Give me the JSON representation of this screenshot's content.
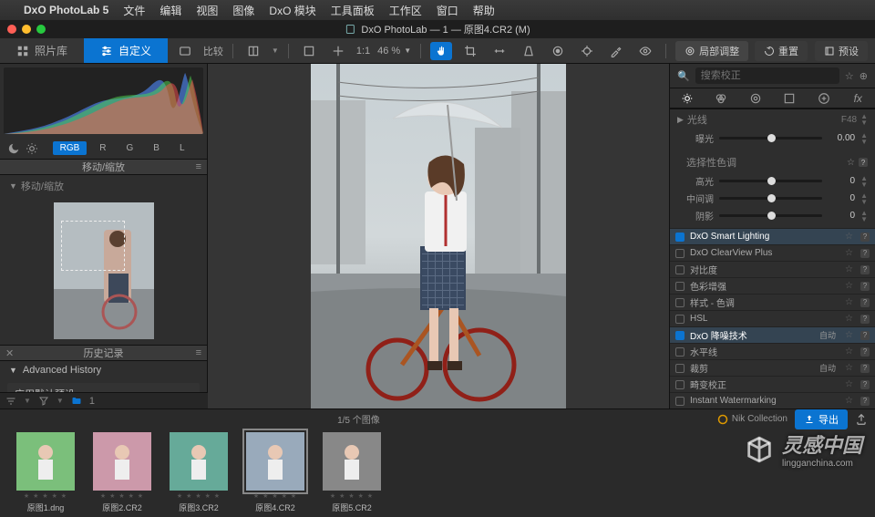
{
  "menubar": {
    "app": "DxO PhotoLab 5",
    "items": [
      "文件",
      "编辑",
      "视图",
      "图像",
      "DxO 模块",
      "工具面板",
      "工作区",
      "窗口",
      "帮助"
    ]
  },
  "titlebar": {
    "title": "DxO PhotoLab — 1 — 原图4.CR2 (M)"
  },
  "modes": {
    "library": "照片库",
    "customize": "自定义"
  },
  "toolbar": {
    "compare": "比较",
    "fit": "1:1",
    "zoom_pct": "46 %",
    "local_adjust": "局部调整",
    "reset": "重置",
    "preset": "预设"
  },
  "left": {
    "channels": {
      "rgb": "RGB",
      "r": "R",
      "g": "G",
      "b": "B",
      "l": "L"
    },
    "move_zoom": "移动/缩放",
    "move_zoom_sub": "移动/缩放",
    "history": "历史记录",
    "adv_history": "Advanced History",
    "history_item": "应用默认预设"
  },
  "right": {
    "search_placeholder": "搜索校正",
    "light_section": "光线",
    "exposure_label": "曝光",
    "exposure_value": "0.00",
    "f_label": "F48",
    "selective_tone": "选择性色调",
    "sliders": [
      {
        "label": "高光",
        "value": "0",
        "pos": 50
      },
      {
        "label": "中间调",
        "value": "0",
        "pos": 50
      },
      {
        "label": "阴影",
        "value": "0",
        "pos": 50
      }
    ],
    "modules": [
      {
        "name": "DxO Smart Lighting",
        "on": true,
        "auto": ""
      },
      {
        "name": "DxO ClearView Plus",
        "on": false,
        "auto": ""
      },
      {
        "name": "对比度",
        "on": false,
        "auto": ""
      },
      {
        "name": "色彩增强",
        "on": false,
        "auto": ""
      },
      {
        "name": "样式 - 色调",
        "on": false,
        "auto": ""
      },
      {
        "name": "HSL",
        "on": false,
        "auto": ""
      },
      {
        "name": "DxO 降噪技术",
        "on": true,
        "auto": "自动"
      },
      {
        "name": "水平线",
        "on": false,
        "auto": ""
      },
      {
        "name": "裁剪",
        "on": false,
        "auto": "自动"
      },
      {
        "name": "畸变校正",
        "on": false,
        "auto": ""
      },
      {
        "name": "Instant Watermarking",
        "on": false,
        "auto": ""
      }
    ]
  },
  "film": {
    "counter": "1/5 个图像",
    "nik": "Nik Collection",
    "export": "导出",
    "folder_badge": "1",
    "thumbs": [
      {
        "name": "原图1.dng"
      },
      {
        "name": "原图2.CR2"
      },
      {
        "name": "原图3.CR2"
      },
      {
        "name": "原图4.CR2"
      },
      {
        "name": "原图5.CR2"
      }
    ],
    "selected_index": 3
  },
  "watermark": {
    "text": "灵感中国",
    "url": "lingganchina.com"
  }
}
